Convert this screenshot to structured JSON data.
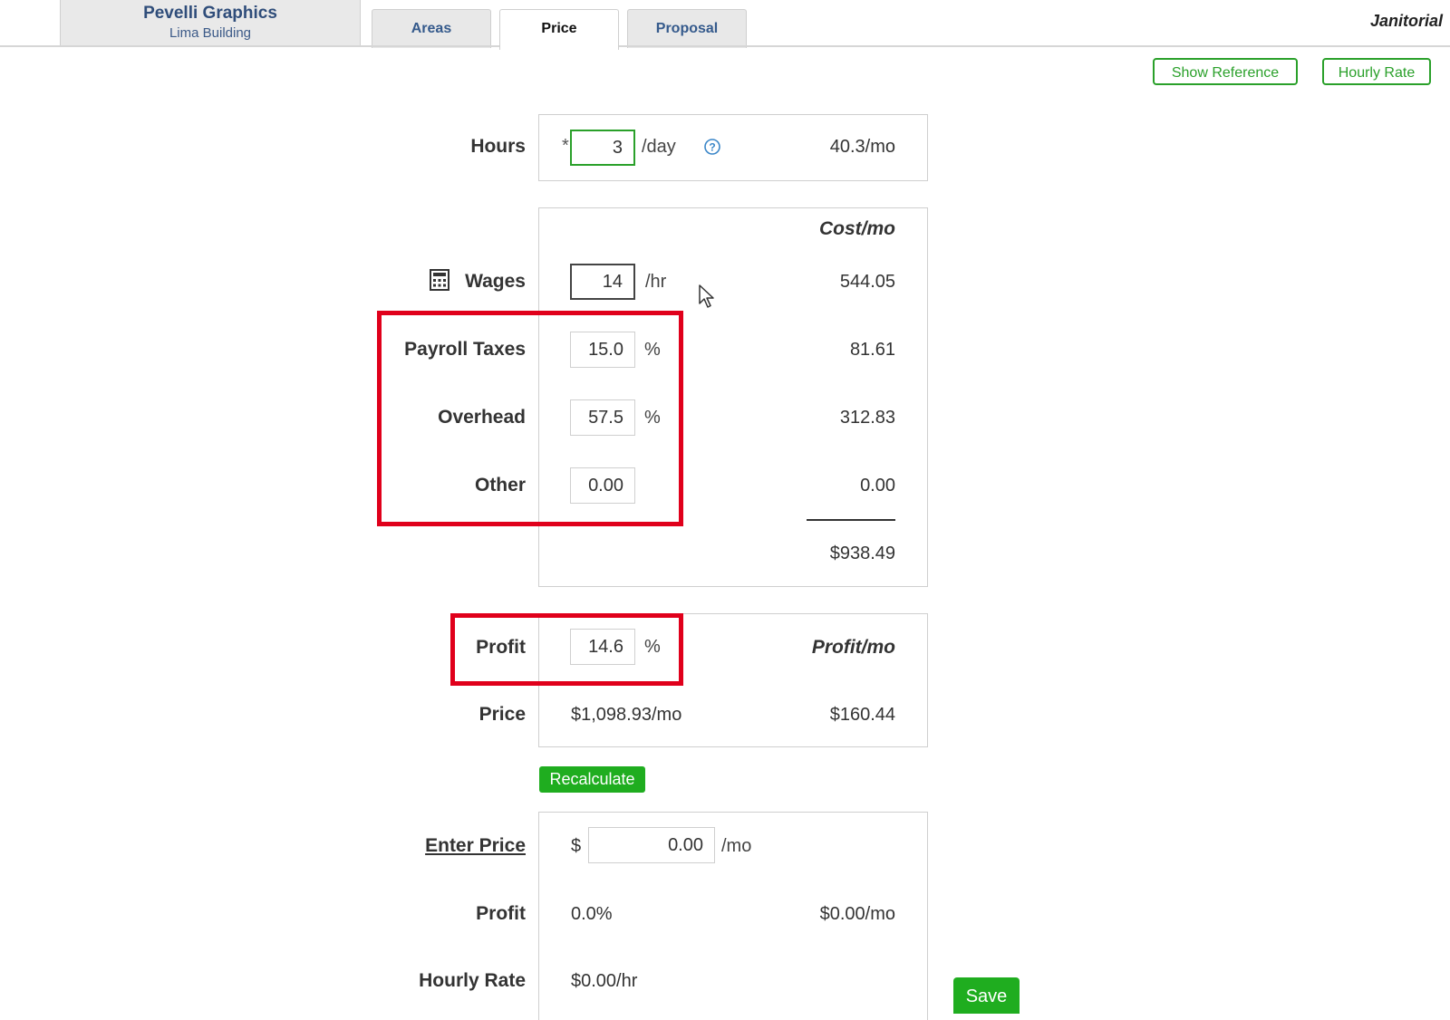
{
  "header": {
    "client_name": "Pevelli Graphics",
    "client_building": "Lima Building",
    "tabs": [
      {
        "label": "Areas",
        "active": false
      },
      {
        "label": "Price",
        "active": true
      },
      {
        "label": "Proposal",
        "active": false
      }
    ],
    "section_title": "Janitorial"
  },
  "toolbar": {
    "show_reference_label": "Show Reference",
    "hourly_rate_label": "Hourly Rate"
  },
  "hours": {
    "label": "Hours",
    "required_mark": "*",
    "value": "3",
    "unit": "/day",
    "monthly": "40.3/mo"
  },
  "costs": {
    "column_header": "Cost/mo",
    "wages": {
      "label": "Wages",
      "value": "14",
      "unit": "/hr",
      "cost": "544.05"
    },
    "payroll_taxes": {
      "label": "Payroll Taxes",
      "value": "15.0",
      "unit": "%",
      "cost": "81.61"
    },
    "overhead": {
      "label": "Overhead",
      "value": "57.5",
      "unit": "%",
      "cost": "312.83"
    },
    "other": {
      "label": "Other",
      "value": "0.00",
      "cost": "0.00"
    },
    "total": "$938.49"
  },
  "profit_section": {
    "label": "Profit",
    "value": "14.6",
    "unit": "%",
    "column_header": "Profit/mo",
    "price_label": "Price",
    "price_value": "$1,098.93/mo",
    "profit_monthly": "$160.44"
  },
  "recalculate_label": "Recalculate",
  "enter_price": {
    "label": "Enter Price",
    "currency": "$",
    "value": "0.00",
    "unit": "/mo",
    "profit_label": "Profit",
    "profit_percent": "0.0%",
    "profit_monthly": "$0.00/mo",
    "hourly_rate_label": "Hourly Rate",
    "hourly_rate_value": "$0.00/hr"
  },
  "save_label": "Save",
  "colors": {
    "accent_green": "#1fad1f",
    "highlight_red": "#e0001b",
    "link_blue": "#355a8c"
  }
}
